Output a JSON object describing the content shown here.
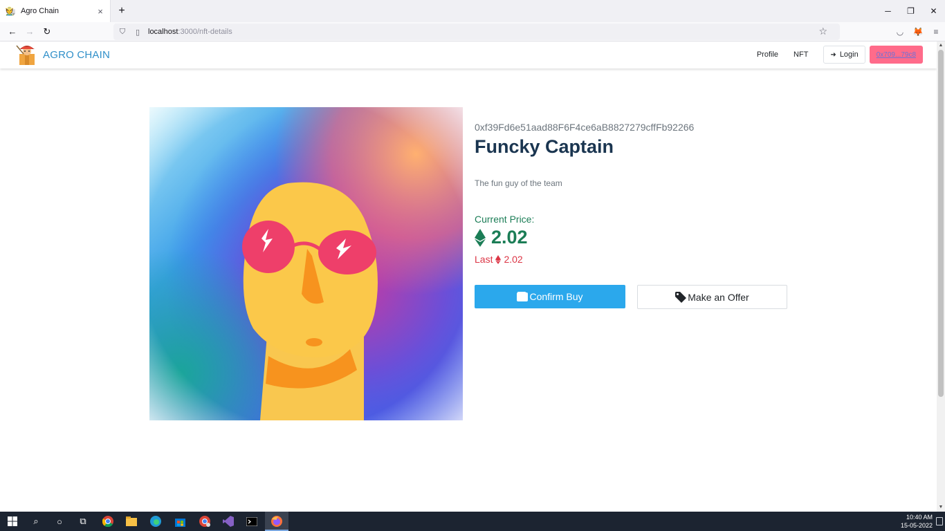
{
  "browser": {
    "tab_title": "Agro Chain",
    "tab_close": "×",
    "new_tab": "+",
    "url_host": "localhost",
    "url_path": ":3000/nft-details",
    "window_controls": [
      "─",
      "❐",
      "✕"
    ]
  },
  "header": {
    "brand": "AGRO CHAIN",
    "nav": {
      "profile": "Profile",
      "nft": "NFT",
      "login": "Login"
    },
    "wallet": "0x709...79c8"
  },
  "nft": {
    "owner": "0xf39Fd6e51aad88F6F4ce6aB8827279cffFb92266",
    "name": "Funcky Captain",
    "description": "The fun guy of the team",
    "price_label": "Current Price:",
    "price": "2.02",
    "last_label": "Last",
    "last_price": "2.02",
    "buy_label": "Confirm Buy",
    "offer_label": "Make an Offer"
  },
  "colors": {
    "brand": "#2f8fc9",
    "price_green": "#1b7d56",
    "last_red": "#dc3545",
    "buy_blue": "#2ba8ec",
    "wallet_pink": "#ff6b8a"
  },
  "taskbar": {
    "time": "10:40 AM",
    "date": "15-05-2022"
  }
}
